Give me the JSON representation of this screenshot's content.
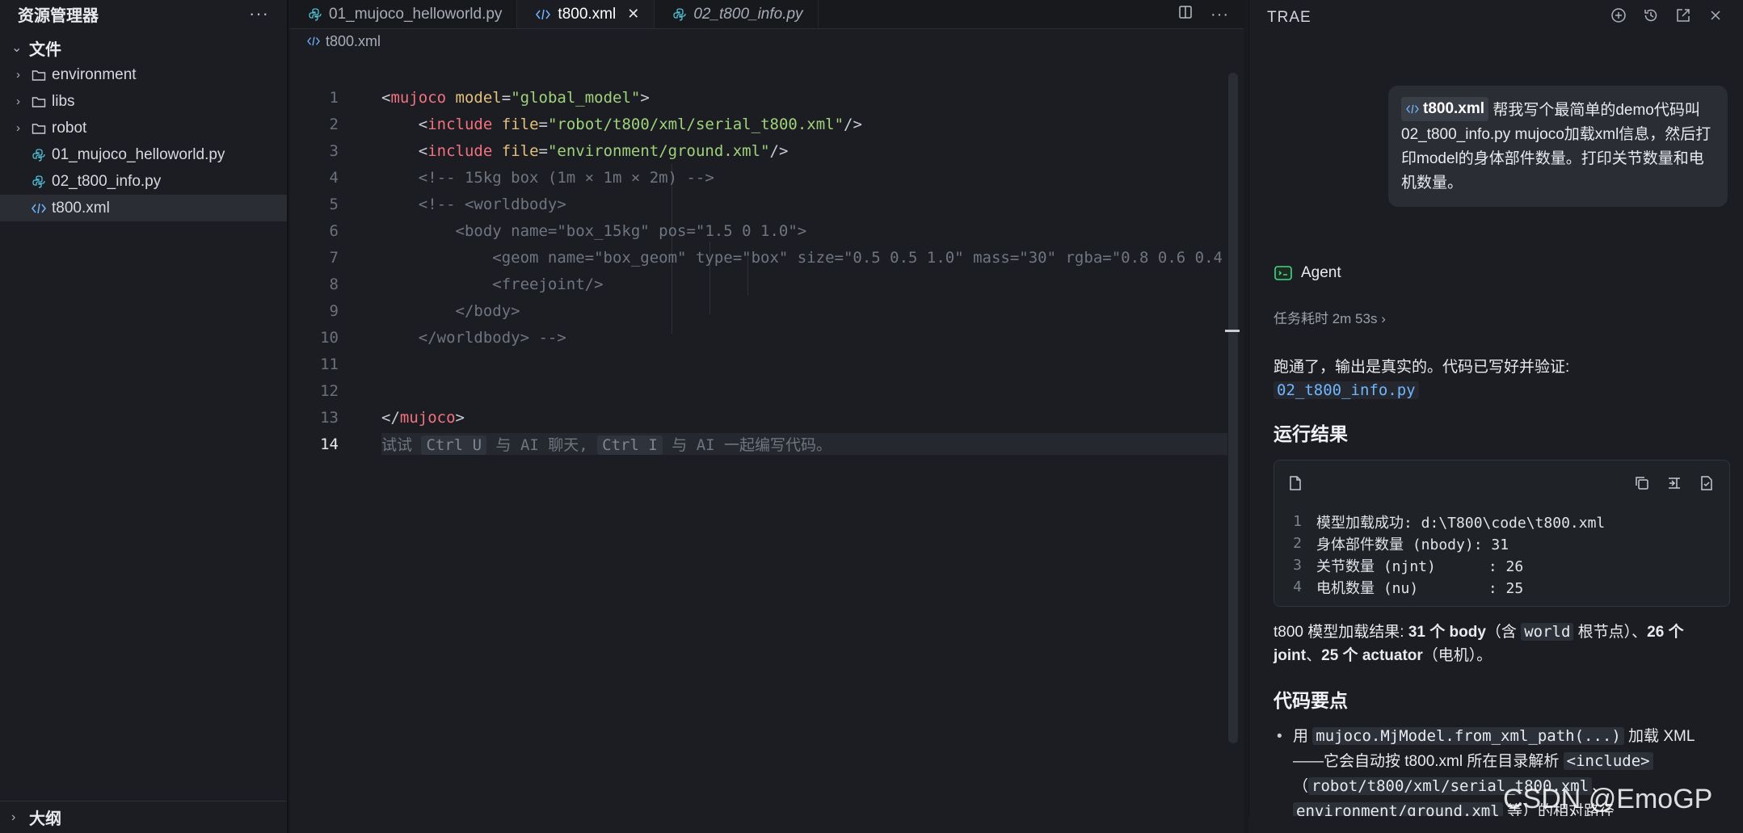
{
  "sidebar": {
    "title": "资源管理器",
    "more": "···",
    "root_label": "文件",
    "items": [
      {
        "label": "environment",
        "type": "folder"
      },
      {
        "label": "libs",
        "type": "folder"
      },
      {
        "label": "robot",
        "type": "folder"
      },
      {
        "label": "01_mujoco_helloworld.py",
        "type": "python"
      },
      {
        "label": "02_t800_info.py",
        "type": "python"
      },
      {
        "label": "t800.xml",
        "type": "xml",
        "selected": true
      }
    ],
    "outline_label": "大纲"
  },
  "editor": {
    "tabs": [
      {
        "label": "01_mujoco_helloworld.py",
        "icon": "python-icon"
      },
      {
        "label": "t800.xml",
        "icon": "xml-icon",
        "active": true,
        "close": "✕"
      },
      {
        "label": "02_t800_info.py",
        "icon": "python-icon",
        "italic": true
      }
    ],
    "breadcrumb": "t800.xml",
    "line_numbers": [
      "1",
      "2",
      "3",
      "4",
      "5",
      "6",
      "7",
      "8",
      "9",
      "10",
      "11",
      "12",
      "13",
      "14"
    ],
    "lines": {
      "l1": {
        "lt": "<",
        "tag": "mujoco",
        "attr": "model",
        "eq": "=",
        "val": "\"global_model\"",
        "gt": ">"
      },
      "l2": {
        "lt": "<",
        "tag": "include",
        "attr": "file",
        "eq": "=",
        "val": "\"robot/t800/xml/serial_t800.xml\"",
        "gt": "/>"
      },
      "l3": {
        "lt": "<",
        "tag": "include",
        "attr": "file",
        "eq": "=",
        "val": "\"environment/ground.xml\"",
        "gt": "/>"
      },
      "l4": "<!-- 15kg box (1m × 1m × 2m) -->",
      "l5": "<!-- <worldbody>",
      "l6": "<body name=\"box_15kg\" pos=\"1.5 0 1.0\">",
      "l7": "<geom name=\"box_geom\" type=\"box\" size=\"0.5 0.5 1.0\" mass=\"30\" rgba=\"0.8 0.6 0.4",
      "l8": "<freejoint/>",
      "l9": "</body>",
      "l10": "</worldbody> -->",
      "l13": {
        "lt": "</",
        "tag": "mujoco",
        "gt": ">"
      },
      "l14": {
        "p1": "试试 ",
        "k1": "Ctrl U",
        "p2": " 与 AI 聊天, ",
        "k2": "Ctrl I",
        "p3": " 与 AI 一起编写代码。"
      }
    }
  },
  "chat": {
    "brand": "TRAE",
    "user_message": {
      "chip": "t800.xml",
      "text": "帮我写个最简单的demo代码叫02_t800_info.py mujoco加载xml信息，然后打印model的身体部件数量。打印关节数量和电机数量。"
    },
    "agent_name": "Agent",
    "timing": "任务耗时 2m 53s",
    "timing_chevron": "›",
    "reply_intro": "跑通了，输出是真实的。代码已写好并验证:",
    "reply_file": "02_t800_info.py",
    "run_heading": "运行结果",
    "output_lines": [
      {
        "n": "1",
        "text": "模型加载成功: d:\\T800\\code\\t800.xml"
      },
      {
        "n": "2",
        "text": "身体部件数量 (nbody): 31"
      },
      {
        "n": "3",
        "text": "关节数量 (njnt)      : 26"
      },
      {
        "n": "4",
        "text": "电机数量 (nu)        : 25"
      }
    ],
    "summary": {
      "prefix": "t800 模型加载结果: ",
      "b1": "31 个 body",
      "mid1": "（含 ",
      "code1": "world",
      "mid2": " 根节点）、",
      "b2": "26 个 joint",
      "mid3": "、",
      "b3": "25 个 actuator",
      "suffix": "（电机）。"
    },
    "key_heading": "代码要点",
    "bullet": {
      "p1": "用 ",
      "c1": "mujoco.MjModel.from_xml_path(...)",
      "p2": " 加载 XML ——它会自动按 t800.xml 所在目录解析 ",
      "c2": "<include>",
      "p3": "（",
      "c3": "robot/t800/xml/serial_t800.xml",
      "p4": "、",
      "c4": "environment/ground.xml",
      "p5": " 等）的相对路径"
    }
  },
  "watermark": "CSDN @EmoGP",
  "colors": {
    "accent": "#6fb6ff",
    "tag": "#f4727f",
    "attr": "#e5c07b",
    "string": "#9fd27a",
    "comment": "#6f7580"
  }
}
